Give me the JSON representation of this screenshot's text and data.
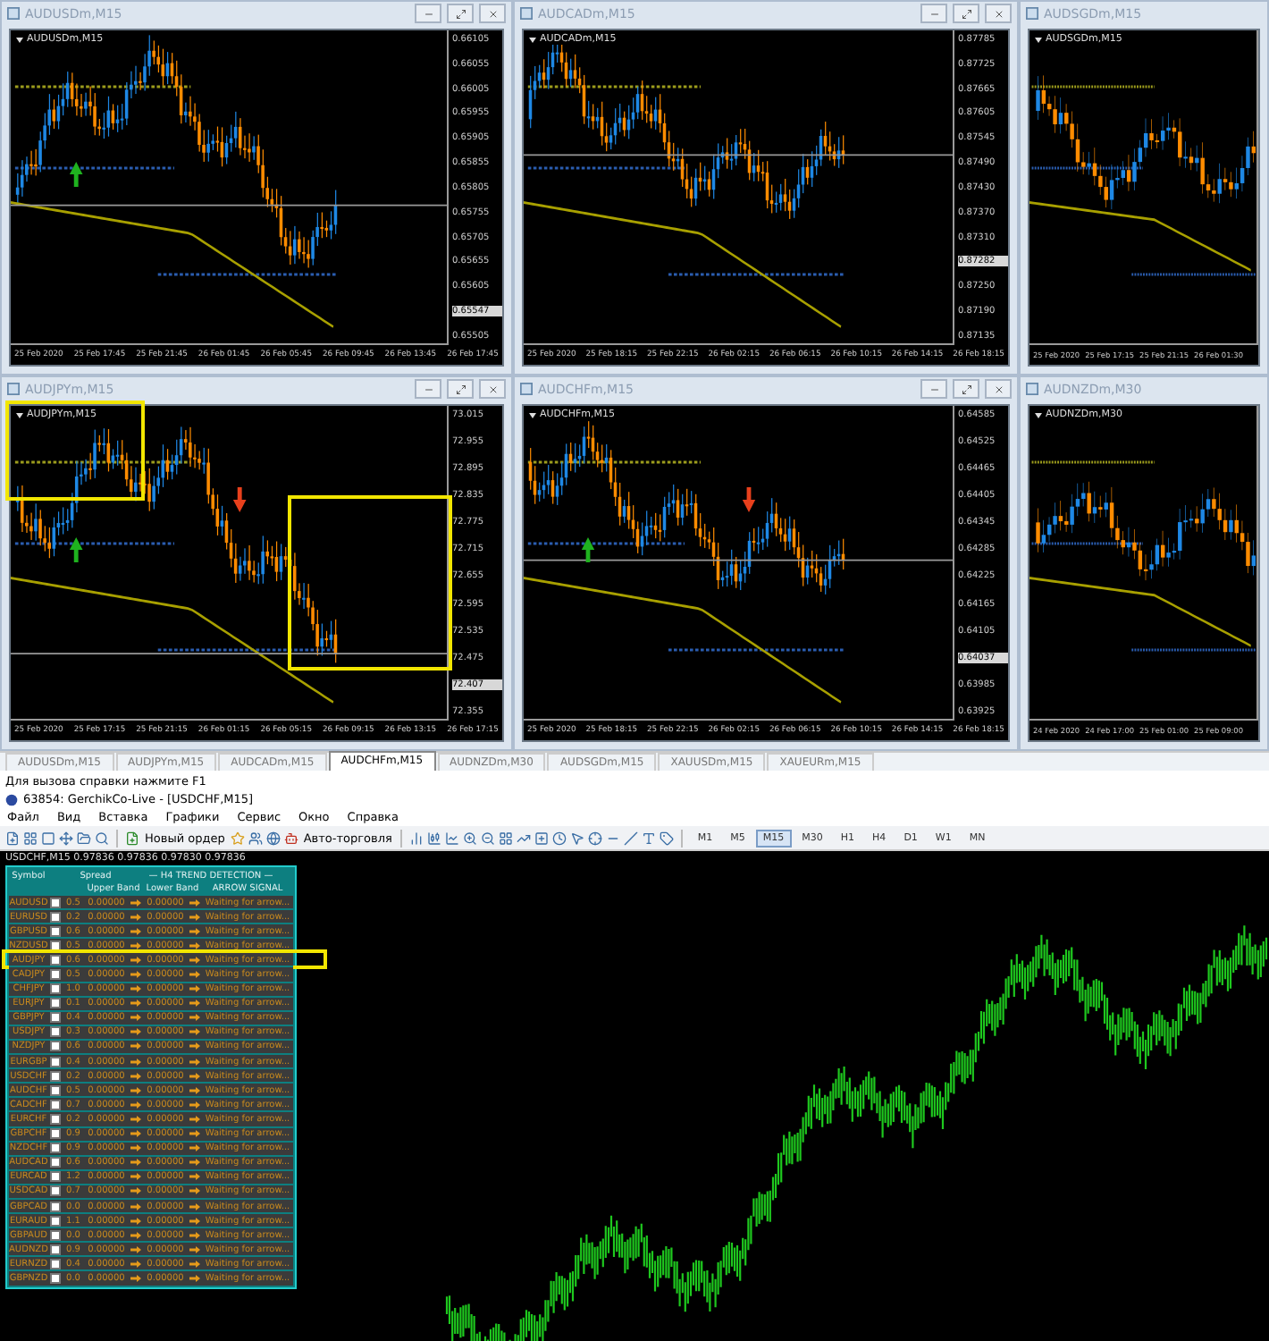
{
  "charts": [
    {
      "title": "AUDUSDm,M15",
      "label": "AUDUSDm,M15",
      "controls": true,
      "up_arrow": true,
      "prices": [
        {
          "text": "0.66105",
          "current": false
        },
        {
          "text": "0.66055",
          "current": false
        },
        {
          "text": "0.66005",
          "current": false
        },
        {
          "text": "0.65955",
          "current": false
        },
        {
          "text": "0.65905",
          "current": false
        },
        {
          "text": "0.65855",
          "current": false
        },
        {
          "text": "0.65805",
          "current": false
        },
        {
          "text": "0.65755",
          "current": false
        },
        {
          "text": "0.65705",
          "current": false
        },
        {
          "text": "0.65655",
          "current": false
        },
        {
          "text": "0.65605",
          "current": false
        },
        {
          "text": "0.65547",
          "current": true
        },
        {
          "text": "0.65505",
          "current": false
        }
      ],
      "times": [
        "25 Feb 2020",
        "25 Feb 17:45",
        "25 Feb 21:45",
        "26 Feb 01:45",
        "26 Feb 05:45",
        "26 Feb 09:45",
        "26 Feb 13:45",
        "26 Feb 17:45"
      ]
    },
    {
      "title": "AUDCADm,M15",
      "label": "AUDCADm,M15",
      "controls": true,
      "prices": [
        {
          "text": "0.87785",
          "current": false
        },
        {
          "text": "0.87725",
          "current": false
        },
        {
          "text": "0.87665",
          "current": false
        },
        {
          "text": "0.87605",
          "current": false
        },
        {
          "text": "0.87545",
          "current": false
        },
        {
          "text": "0.87490",
          "current": false
        },
        {
          "text": "0.87430",
          "current": false
        },
        {
          "text": "0.87370",
          "current": false
        },
        {
          "text": "0.87310",
          "current": false
        },
        {
          "text": "0.87282",
          "current": true
        },
        {
          "text": "0.87250",
          "current": false
        },
        {
          "text": "0.87190",
          "current": false
        },
        {
          "text": "0.87135",
          "current": false
        }
      ],
      "times": [
        "25 Feb 2020",
        "25 Feb 18:15",
        "25 Feb 22:15",
        "26 Feb 02:15",
        "26 Feb 06:15",
        "26 Feb 10:15",
        "26 Feb 14:15",
        "26 Feb 18:15"
      ]
    },
    {
      "title": "AUDSGDm,M15",
      "label": "AUDSGDm,M15",
      "times": [
        "25 Feb 2020",
        "25 Feb 17:15",
        "25 Feb 21:15",
        "26 Feb 01:30"
      ]
    },
    {
      "title": "AUDJPYm,M15",
      "label": "AUDJPYm,M15",
      "controls": true,
      "marked": true,
      "up_arrow": true,
      "down_arrow": true,
      "prices": [
        {
          "text": "73.015",
          "current": false
        },
        {
          "text": "72.955",
          "current": false
        },
        {
          "text": "72.895",
          "current": false
        },
        {
          "text": "72.835",
          "current": false
        },
        {
          "text": "72.775",
          "current": false
        },
        {
          "text": "72.715",
          "current": false
        },
        {
          "text": "72.655",
          "current": false
        },
        {
          "text": "72.595",
          "current": false
        },
        {
          "text": "72.535",
          "current": false
        },
        {
          "text": "72.475",
          "current": false
        },
        {
          "text": "72.407",
          "current": true
        },
        {
          "text": "72.355",
          "current": false
        }
      ],
      "times": [
        "25 Feb 2020",
        "25 Feb 17:15",
        "25 Feb 21:15",
        "26 Feb 01:15",
        "26 Feb 05:15",
        "26 Feb 09:15",
        "26 Feb 13:15",
        "26 Feb 17:15"
      ]
    },
    {
      "title": "AUDCHFm,M15",
      "label": "AUDCHFm,M15",
      "controls": true,
      "up_arrow": true,
      "down_arrow": true,
      "prices": [
        {
          "text": "0.64585",
          "current": false
        },
        {
          "text": "0.64525",
          "current": false
        },
        {
          "text": "0.64465",
          "current": false
        },
        {
          "text": "0.64405",
          "current": false
        },
        {
          "text": "0.64345",
          "current": false
        },
        {
          "text": "0.64285",
          "current": false
        },
        {
          "text": "0.64225",
          "current": false
        },
        {
          "text": "0.64165",
          "current": false
        },
        {
          "text": "0.64105",
          "current": false
        },
        {
          "text": "0.64037",
          "current": true
        },
        {
          "text": "0.63985",
          "current": false
        },
        {
          "text": "0.63925",
          "current": false
        }
      ],
      "times": [
        "25 Feb 2020",
        "25 Feb 18:15",
        "25 Feb 22:15",
        "26 Feb 02:15",
        "26 Feb 06:15",
        "26 Feb 10:15",
        "26 Feb 14:15",
        "26 Feb 18:15"
      ]
    },
    {
      "title": "AUDNZDm,M30",
      "label": "AUDNZDm,M30",
      "times": [
        "24 Feb 2020",
        "24 Feb 17:00",
        "25 Feb 01:00",
        "25 Feb 09:00"
      ]
    }
  ],
  "chart_tabs": [
    {
      "label": "AUDUSDm,M15",
      "selected": false
    },
    {
      "label": "AUDJPYm,M15",
      "selected": false
    },
    {
      "label": "AUDCADm,M15",
      "selected": false
    },
    {
      "label": "AUDCHFm,M15",
      "selected": true
    },
    {
      "label": "AUDNZDm,M30",
      "selected": false
    },
    {
      "label": "AUDSGDm,M15",
      "selected": false
    },
    {
      "label": "XAUUSDm,M15",
      "selected": false
    },
    {
      "label": "XAUEURm,M15",
      "selected": false
    }
  ],
  "status_bar": "Для вызова справки нажмите F1",
  "window": {
    "title": "63854: GerchikCo-Live - [USDCHF,M15]"
  },
  "menu": [
    "Файл",
    "Вид",
    "Вставка",
    "Графики",
    "Сервис",
    "Окно",
    "Справка"
  ],
  "toolbar": {
    "new_order": "Новый ордер",
    "auto_trading": "Авто-торговля",
    "timeframes": [
      {
        "label": "M1",
        "selected": false
      },
      {
        "label": "M5",
        "selected": false
      },
      {
        "label": "M15",
        "selected": true
      },
      {
        "label": "M30",
        "selected": false
      },
      {
        "label": "H1",
        "selected": false
      },
      {
        "label": "H4",
        "selected": false
      },
      {
        "label": "D1",
        "selected": false
      },
      {
        "label": "W1",
        "selected": false
      },
      {
        "label": "MN",
        "selected": false
      }
    ]
  },
  "main_chart": {
    "label": "USDCHF,M15  0.97836 0.97836 0.97830 0.97836",
    "panel": {
      "columns": {
        "symbol": "Symbol",
        "spread": "Spread",
        "group": "— H4  TREND DETECTION —",
        "upper": "Upper Band",
        "lower": "Lower Band",
        "signal": "ARROW SIGNAL"
      },
      "rows": [
        {
          "symbol": "AUDUSD",
          "checked": false,
          "spread": "0.5",
          "upper": "0.00000",
          "lower": "0.00000",
          "signal": "Waiting for arrow..."
        },
        {
          "symbol": "EURUSD",
          "checked": false,
          "spread": "0.2",
          "upper": "0.00000",
          "lower": "0.00000",
          "signal": "Waiting for arrow..."
        },
        {
          "symbol": "GBPUSD",
          "checked": false,
          "spread": "0.6",
          "upper": "0.00000",
          "lower": "0.00000",
          "signal": "Waiting for arrow..."
        },
        {
          "symbol": "NZDUSD",
          "checked": false,
          "spread": "0.5",
          "upper": "0.00000",
          "lower": "0.00000",
          "signal": "Waiting for arrow..."
        },
        {
          "symbol": "AUDJPY",
          "checked": false,
          "spread": "0.6",
          "upper": "0.00000",
          "lower": "0.00000",
          "signal": "Waiting for arrow...",
          "marked": true
        },
        {
          "symbol": "CADJPY",
          "checked": false,
          "spread": "0.5",
          "upper": "0.00000",
          "lower": "0.00000",
          "signal": "Waiting for arrow..."
        },
        {
          "symbol": "CHFJPY",
          "checked": false,
          "spread": "1.0",
          "upper": "0.00000",
          "lower": "0.00000",
          "signal": "Waiting for arrow..."
        },
        {
          "symbol": "EURJPY",
          "checked": false,
          "spread": "0.1",
          "upper": "0.00000",
          "lower": "0.00000",
          "signal": "Waiting for arrow..."
        },
        {
          "symbol": "GBPJPY",
          "checked": false,
          "spread": "0.4",
          "upper": "0.00000",
          "lower": "0.00000",
          "signal": "Waiting for arrow..."
        },
        {
          "symbol": "USDJPY",
          "checked": false,
          "spread": "0.3",
          "upper": "0.00000",
          "lower": "0.00000",
          "signal": "Waiting for arrow..."
        },
        {
          "symbol": "NZDJPY",
          "checked": false,
          "spread": "0.6",
          "upper": "0.00000",
          "lower": "0.00000",
          "signal": "Waiting for arrow..."
        },
        {
          "symbol": "EURGBP",
          "checked": false,
          "spread": "0.4",
          "upper": "0.00000",
          "lower": "0.00000",
          "signal": "Waiting for arrow..."
        },
        {
          "symbol": "USDCHF",
          "checked": false,
          "spread": "0.2",
          "upper": "0.00000",
          "lower": "0.00000",
          "signal": "Waiting for arrow..."
        },
        {
          "symbol": "AUDCHF",
          "checked": false,
          "spread": "0.5",
          "upper": "0.00000",
          "lower": "0.00000",
          "signal": "Waiting for arrow..."
        },
        {
          "symbol": "CADCHF",
          "checked": false,
          "spread": "0.7",
          "upper": "0.00000",
          "lower": "0.00000",
          "signal": "Waiting for arrow..."
        },
        {
          "symbol": "EURCHF",
          "checked": false,
          "spread": "0.2",
          "upper": "0.00000",
          "lower": "0.00000",
          "signal": "Waiting for arrow..."
        },
        {
          "symbol": "GBPCHF",
          "checked": false,
          "spread": "0.9",
          "upper": "0.00000",
          "lower": "0.00000",
          "signal": "Waiting for arrow..."
        },
        {
          "symbol": "NZDCHF",
          "checked": false,
          "spread": "0.9",
          "upper": "0.00000",
          "lower": "0.00000",
          "signal": "Waiting for arrow..."
        },
        {
          "symbol": "AUDCAD",
          "checked": false,
          "spread": "0.6",
          "upper": "0.00000",
          "lower": "0.00000",
          "signal": "Waiting for arrow..."
        },
        {
          "symbol": "EURCAD",
          "checked": false,
          "spread": "1.2",
          "upper": "0.00000",
          "lower": "0.00000",
          "signal": "Waiting for arrow..."
        },
        {
          "symbol": "USDCAD",
          "checked": false,
          "spread": "0.7",
          "upper": "0.00000",
          "lower": "0.00000",
          "signal": "Waiting for arrow..."
        },
        {
          "symbol": "GBPCAD",
          "checked": false,
          "spread": "0.0",
          "upper": "0.00000",
          "lower": "0.00000",
          "signal": "Waiting for arrow..."
        },
        {
          "symbol": "EURAUD",
          "checked": false,
          "spread": "1.1",
          "upper": "0.00000",
          "lower": "0.00000",
          "signal": "Waiting for arrow..."
        },
        {
          "symbol": "GBPAUD",
          "checked": false,
          "spread": "0.0",
          "upper": "0.00000",
          "lower": "0.00000",
          "signal": "Waiting for arrow..."
        },
        {
          "symbol": "AUDNZD",
          "checked": false,
          "spread": "0.9",
          "upper": "0.00000",
          "lower": "0.00000",
          "signal": "Waiting for arrow..."
        },
        {
          "symbol": "EURNZD",
          "checked": false,
          "spread": "0.4",
          "upper": "0.00000",
          "lower": "0.00000",
          "signal": "Waiting for arrow..."
        },
        {
          "symbol": "GBPNZD",
          "checked": false,
          "spread": "0.0",
          "upper": "0.00000",
          "lower": "0.00000",
          "signal": "Waiting for arrow..."
        }
      ]
    }
  }
}
